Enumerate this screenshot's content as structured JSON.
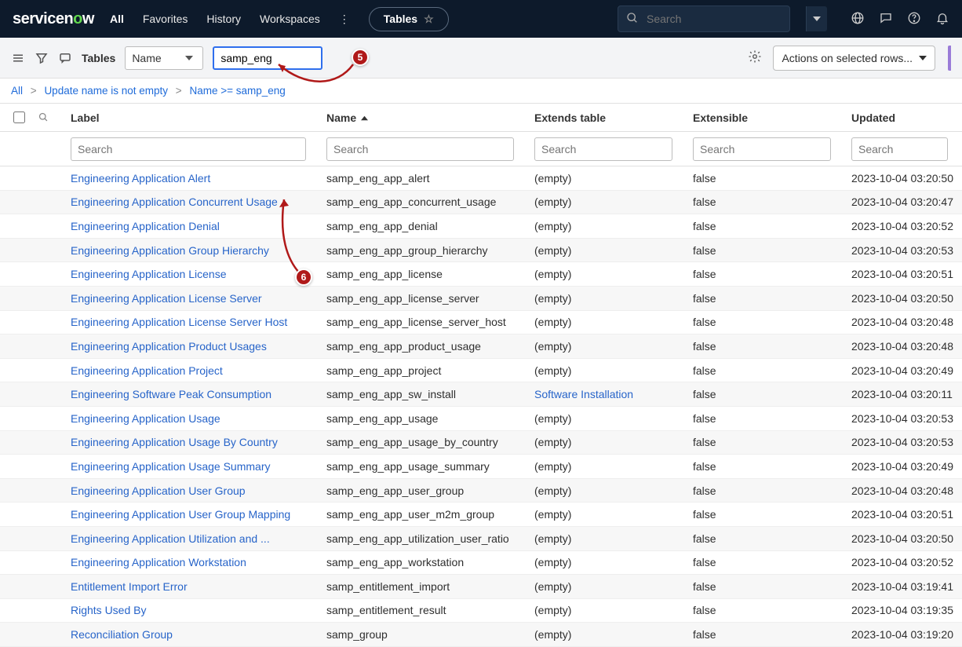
{
  "brand": {
    "name": "servicenow"
  },
  "nav": {
    "all": "All",
    "favorites": "Favorites",
    "history": "History",
    "workspaces": "Workspaces",
    "pill": "Tables"
  },
  "global_search": {
    "placeholder": "Search"
  },
  "toolbar": {
    "title": "Tables",
    "select_label": "Name",
    "input_value": "samp_eng",
    "actions_label": "Actions on selected rows..."
  },
  "breadcrumb": {
    "all": "All",
    "b1": "Update name is not empty",
    "b2": "Name >= samp_eng"
  },
  "columns": {
    "label": "Label",
    "name": "Name",
    "extends": "Extends table",
    "extensible": "Extensible",
    "updated": "Updated",
    "search_placeholder": "Search"
  },
  "annotations": {
    "badge5": "5",
    "badge6": "6"
  },
  "rows": [
    {
      "label": "Engineering Application Alert",
      "name": "samp_eng_app_alert",
      "extends": "(empty)",
      "extensible": "false",
      "updated": "2023-10-04 03:20:50"
    },
    {
      "label": "Engineering Application Concurrent Usage",
      "name": "samp_eng_app_concurrent_usage",
      "extends": "(empty)",
      "extensible": "false",
      "updated": "2023-10-04 03:20:47"
    },
    {
      "label": "Engineering Application Denial",
      "name": "samp_eng_app_denial",
      "extends": "(empty)",
      "extensible": "false",
      "updated": "2023-10-04 03:20:52"
    },
    {
      "label": "Engineering Application Group Hierarchy",
      "name": "samp_eng_app_group_hierarchy",
      "extends": "(empty)",
      "extensible": "false",
      "updated": "2023-10-04 03:20:53"
    },
    {
      "label": "Engineering Application License",
      "name": "samp_eng_app_license",
      "extends": "(empty)",
      "extensible": "false",
      "updated": "2023-10-04 03:20:51"
    },
    {
      "label": "Engineering Application License Server",
      "name": "samp_eng_app_license_server",
      "extends": "(empty)",
      "extensible": "false",
      "updated": "2023-10-04 03:20:50"
    },
    {
      "label": "Engineering Application License Server Host",
      "name": "samp_eng_app_license_server_host",
      "extends": "(empty)",
      "extensible": "false",
      "updated": "2023-10-04 03:20:48"
    },
    {
      "label": "Engineering Application Product Usages",
      "name": "samp_eng_app_product_usage",
      "extends": "(empty)",
      "extensible": "false",
      "updated": "2023-10-04 03:20:48"
    },
    {
      "label": "Engineering Application Project",
      "name": "samp_eng_app_project",
      "extends": "(empty)",
      "extensible": "false",
      "updated": "2023-10-04 03:20:49"
    },
    {
      "label": "Engineering Software Peak Consumption",
      "name": "samp_eng_app_sw_install",
      "extends": "Software Installation",
      "extends_link": true,
      "extensible": "false",
      "updated": "2023-10-04 03:20:11"
    },
    {
      "label": "Engineering Application Usage",
      "name": "samp_eng_app_usage",
      "extends": "(empty)",
      "extensible": "false",
      "updated": "2023-10-04 03:20:53"
    },
    {
      "label": "Engineering Application Usage By Country",
      "name": "samp_eng_app_usage_by_country",
      "extends": "(empty)",
      "extensible": "false",
      "updated": "2023-10-04 03:20:53"
    },
    {
      "label": "Engineering Application Usage Summary",
      "name": "samp_eng_app_usage_summary",
      "extends": "(empty)",
      "extensible": "false",
      "updated": "2023-10-04 03:20:49"
    },
    {
      "label": "Engineering Application User Group",
      "name": "samp_eng_app_user_group",
      "extends": "(empty)",
      "extensible": "false",
      "updated": "2023-10-04 03:20:48"
    },
    {
      "label": "Engineering Application User Group Mapping",
      "name": "samp_eng_app_user_m2m_group",
      "extends": "(empty)",
      "extensible": "false",
      "updated": "2023-10-04 03:20:51"
    },
    {
      "label": "Engineering Application Utilization and ...",
      "name": "samp_eng_app_utilization_user_ratio",
      "extends": "(empty)",
      "extensible": "false",
      "updated": "2023-10-04 03:20:50"
    },
    {
      "label": "Engineering Application Workstation",
      "name": "samp_eng_app_workstation",
      "extends": "(empty)",
      "extensible": "false",
      "updated": "2023-10-04 03:20:52"
    },
    {
      "label": "Entitlement Import Error",
      "name": "samp_entitlement_import",
      "extends": "(empty)",
      "extensible": "false",
      "updated": "2023-10-04 03:19:41"
    },
    {
      "label": "Rights Used By",
      "name": "samp_entitlement_result",
      "extends": "(empty)",
      "extensible": "false",
      "updated": "2023-10-04 03:19:35"
    },
    {
      "label": "Reconciliation Group",
      "name": "samp_group",
      "extends": "(empty)",
      "extensible": "false",
      "updated": "2023-10-04 03:19:20"
    }
  ]
}
